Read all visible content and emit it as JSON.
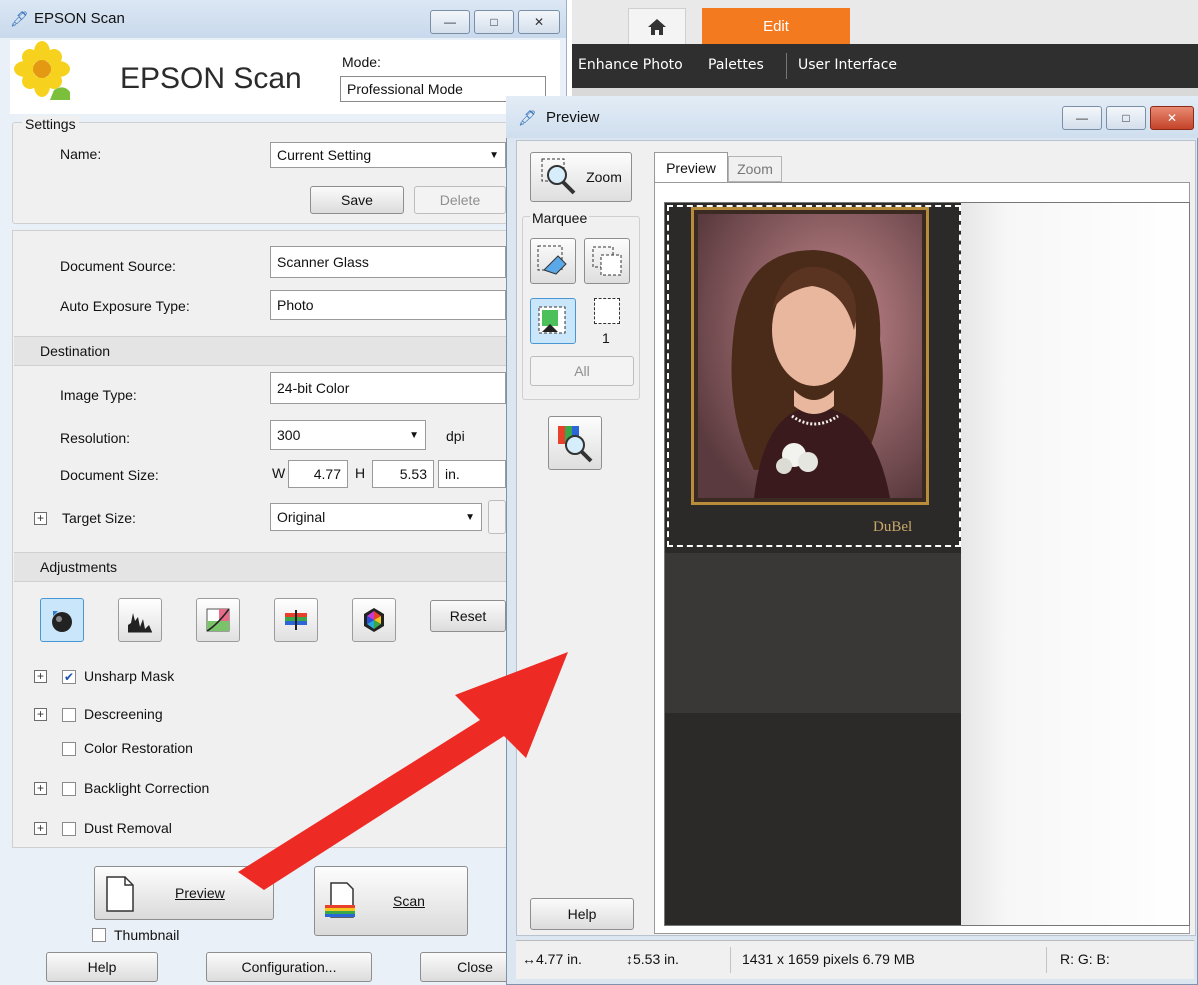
{
  "background_app": {
    "edit_tab": "Edit",
    "menu": [
      "Enhance Photo",
      "Palettes",
      "User Interface"
    ]
  },
  "main_window": {
    "title": "EPSON Scan",
    "logo_text": "EPSON Scan",
    "mode_label": "Mode:",
    "mode_value": "Professional Mode",
    "settings": {
      "group_label": "Settings",
      "name_label": "Name:",
      "name_value": "Current Setting",
      "save_label": "Save",
      "delete_label": "Delete"
    },
    "document_source_label": "Document Source:",
    "document_source_value": "Scanner Glass",
    "auto_exposure_label": "Auto Exposure Type:",
    "auto_exposure_value": "Photo",
    "destination_label": "Destination",
    "image_type_label": "Image Type:",
    "image_type_value": "24-bit Color",
    "resolution_label": "Resolution:",
    "resolution_value": "300",
    "resolution_unit": "dpi",
    "document_size_label": "Document Size:",
    "width_label": "W",
    "width_value": "4.77",
    "height_label": "H",
    "height_value": "5.53",
    "size_unit": "in.",
    "target_size_label": "Target Size:",
    "target_size_value": "Original",
    "adjustments_label": "Adjustments",
    "reset_label": "Reset",
    "options": [
      {
        "label": "Unsharp Mask",
        "checked": true,
        "expandable": true
      },
      {
        "label": "Descreening",
        "checked": false,
        "expandable": true
      },
      {
        "label": "Color Restoration",
        "checked": false,
        "expandable": false
      },
      {
        "label": "Backlight Correction",
        "checked": false,
        "expandable": true
      },
      {
        "label": "Dust Removal",
        "checked": false,
        "expandable": true
      }
    ],
    "preview_label": "Preview",
    "scan_label": "Scan",
    "thumbnail_label": "Thumbnail",
    "help_label": "Help",
    "configuration_label": "Configuration...",
    "close_label": "Close"
  },
  "preview_window": {
    "title": "Preview",
    "zoom_label": "Zoom",
    "marquee_label": "Marquee",
    "marquee_count": "1",
    "all_label": "All",
    "help_label": "Help",
    "tabs": [
      "Preview",
      "Zoom"
    ],
    "photo_caption": "DuBel",
    "status": {
      "width": "4.77 in.",
      "height": "5.53 in.",
      "pixels": "1431 x 1659 pixels 6.79 MB",
      "rgb": "R: G: B:"
    }
  },
  "colors": {
    "accent_orange": "#f47a20",
    "annotation_arrow": "#ee2a24"
  }
}
